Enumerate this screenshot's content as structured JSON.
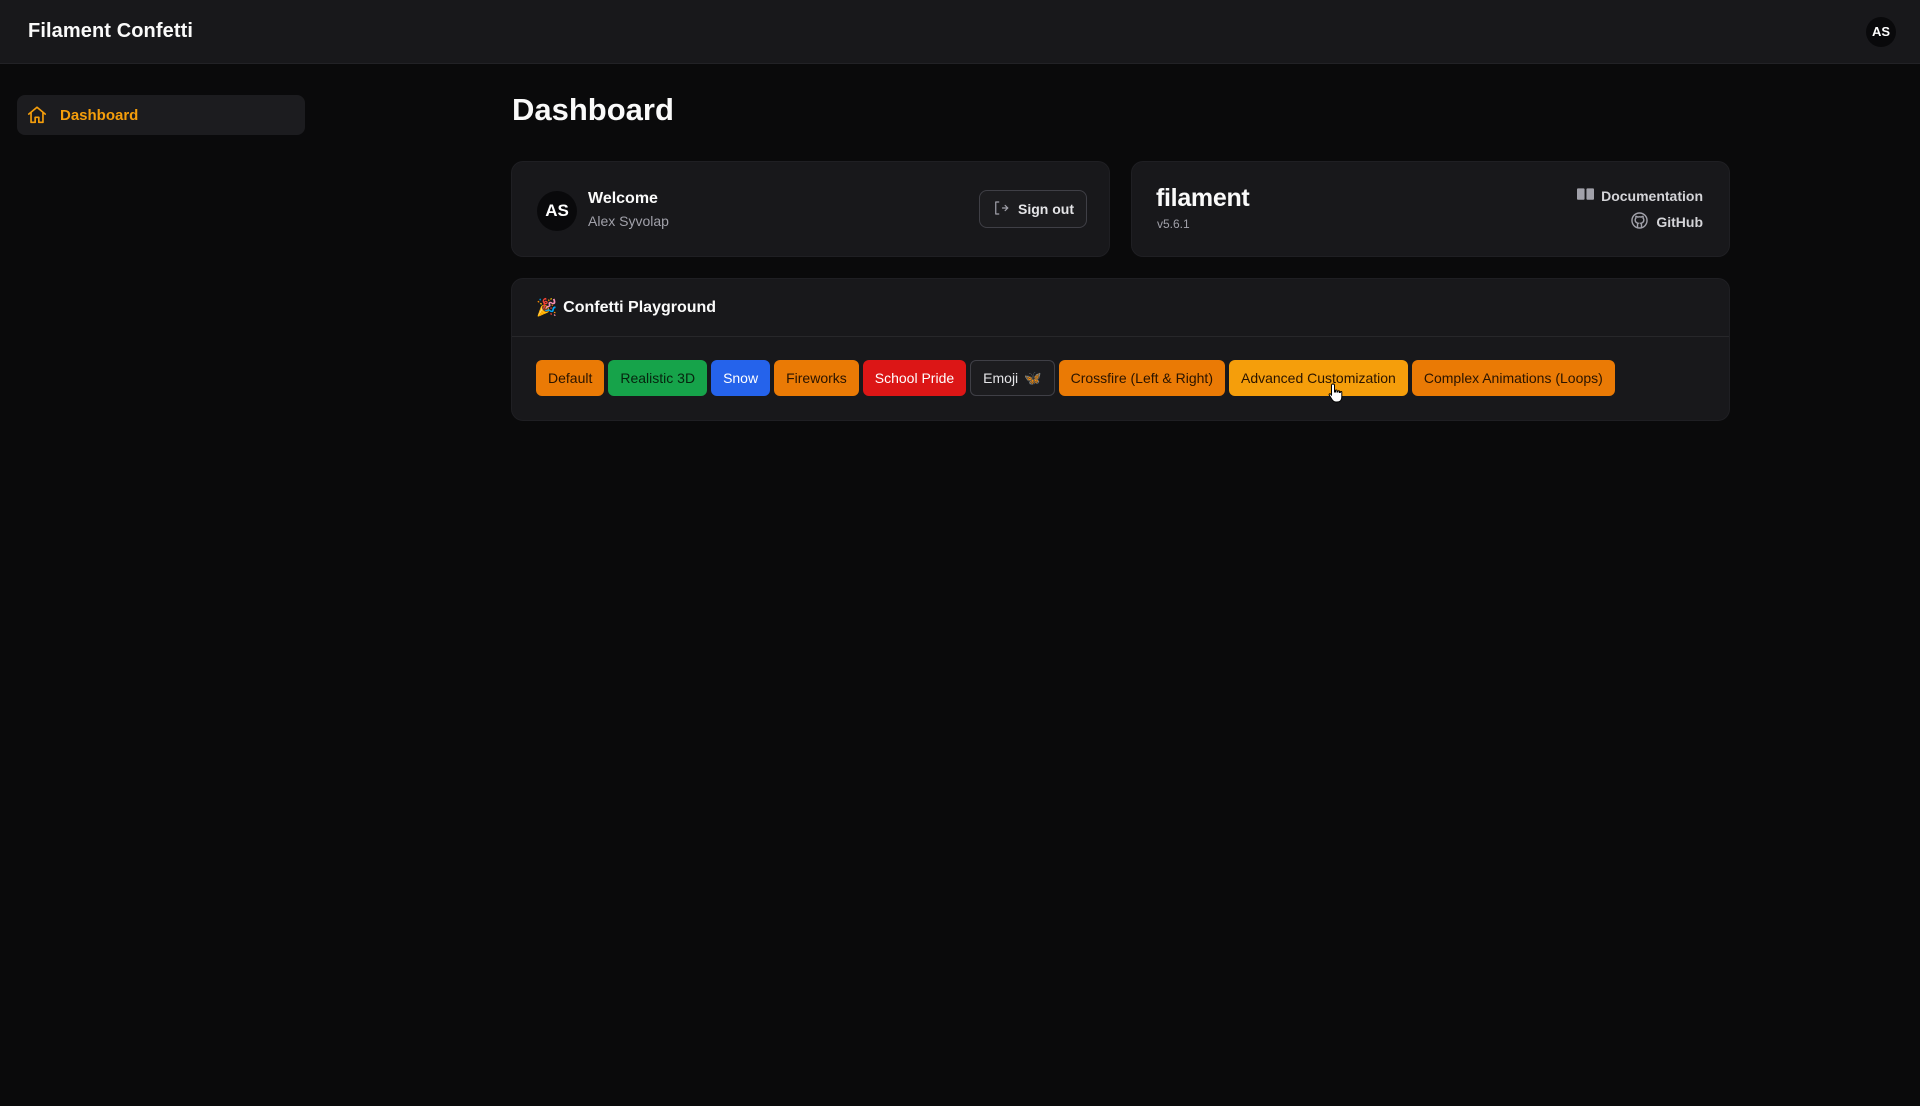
{
  "topbar": {
    "brand": "Filament Confetti",
    "avatar_initials": "AS"
  },
  "sidebar": {
    "items": [
      {
        "label": "Dashboard",
        "icon": "home-icon",
        "active": true,
        "color": "#f59e0b"
      }
    ]
  },
  "page": {
    "title": "Dashboard"
  },
  "welcome": {
    "avatar_initials": "AS",
    "title": "Welcome",
    "name": "Alex Syvolap",
    "signout_label": "Sign out"
  },
  "filament": {
    "logo": "filament",
    "version": "v5.6.1",
    "documentation_label": "Documentation",
    "github_label": "GitHub"
  },
  "playground": {
    "icon": "party-popper-icon",
    "title": "Confetti Playground",
    "buttons": [
      {
        "label": "Default",
        "bg": "#ea7a05",
        "fg": "#2a1400"
      },
      {
        "label": "Realistic 3D",
        "bg": "#16a34a",
        "fg": "#06240f"
      },
      {
        "label": "Snow",
        "bg": "#2563eb",
        "fg": "#ffffff"
      },
      {
        "label": "Fireworks",
        "bg": "#ea7a05",
        "fg": "#2a1400"
      },
      {
        "label": "School Pride",
        "bg": "#dc1616",
        "fg": "#ffffff"
      },
      {
        "label": "Emoji",
        "bg": "#1c1c1f",
        "fg": "#e4e4e7",
        "emoji": "🦋"
      },
      {
        "label": "Crossfire (Left & Right)",
        "bg": "#ea7a05",
        "fg": "#2a1400"
      },
      {
        "label": "Advanced Customization",
        "bg": "#f59e0b",
        "fg": "#2a1400"
      },
      {
        "label": "Complex Animations (Loops)",
        "bg": "#ea7a05",
        "fg": "#2a1400"
      }
    ]
  }
}
